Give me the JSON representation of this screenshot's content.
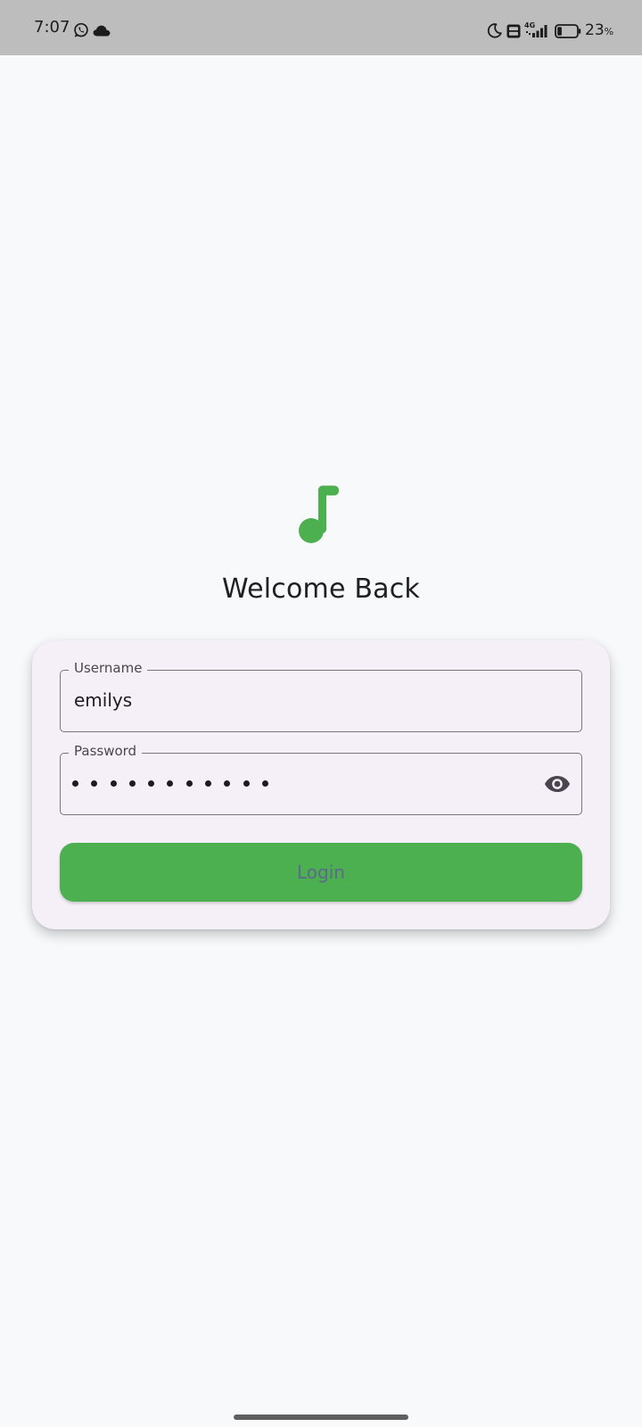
{
  "status_bar": {
    "time": "7:07",
    "network": "4G",
    "battery_percent": "23",
    "battery_percent_sign": "%",
    "battery_level": 0.23,
    "icons": [
      "whatsapp-icon",
      "cloud-icon",
      "moon-icon",
      "volte-icon",
      "signal-icon",
      "battery-icon"
    ]
  },
  "header": {
    "logo_icon": "music-note-icon",
    "title": "Welcome Back"
  },
  "form": {
    "username": {
      "label": "Username",
      "value": "emilys"
    },
    "password": {
      "label": "Password",
      "masked_length": 11,
      "toggle_icon": "eye-icon"
    },
    "login_button": {
      "label": "Login"
    }
  },
  "colors": {
    "accent": "#4caf50",
    "button_text": "#5c6a8c",
    "background": "#f8f9fb",
    "card_background": "#f5f0f7",
    "status_bar": "#bdbdbd"
  }
}
